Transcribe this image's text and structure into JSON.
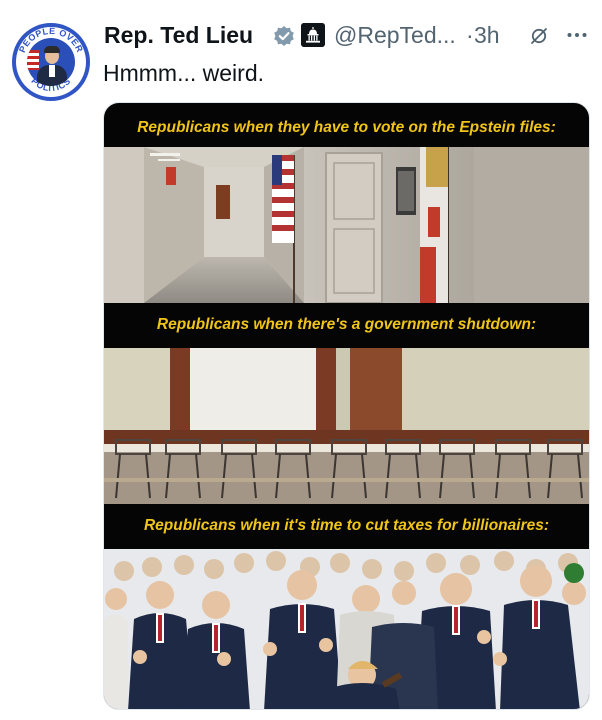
{
  "tweet": {
    "author_name": "Rep. Ted Lieu",
    "handle": "@RepTed...",
    "separator": "·",
    "time": "3h",
    "text": "Hmmm... weird.",
    "avatar_badge_text_top": "PEOPLE OVER",
    "avatar_badge_text_bottom": "POLITICS",
    "verified_color": "#829aab",
    "accent_color": "#1d9bf0"
  },
  "media": {
    "panels": [
      {
        "caption": "Republicans when they have to vote on the Epstein files:",
        "scene": "empty-hallway"
      },
      {
        "caption": "Republicans when there's a government shutdown:",
        "scene": "empty-hearing-room"
      },
      {
        "caption": "Republicans when it's time to cut taxes for billionaires:",
        "scene": "crowded-celebration"
      }
    ],
    "caption_color": "#f0c419"
  },
  "icons": {
    "verified": "verified-badge-icon",
    "government": "capitol-building-icon",
    "grok": "grok-icon",
    "more": "more-options-icon"
  }
}
